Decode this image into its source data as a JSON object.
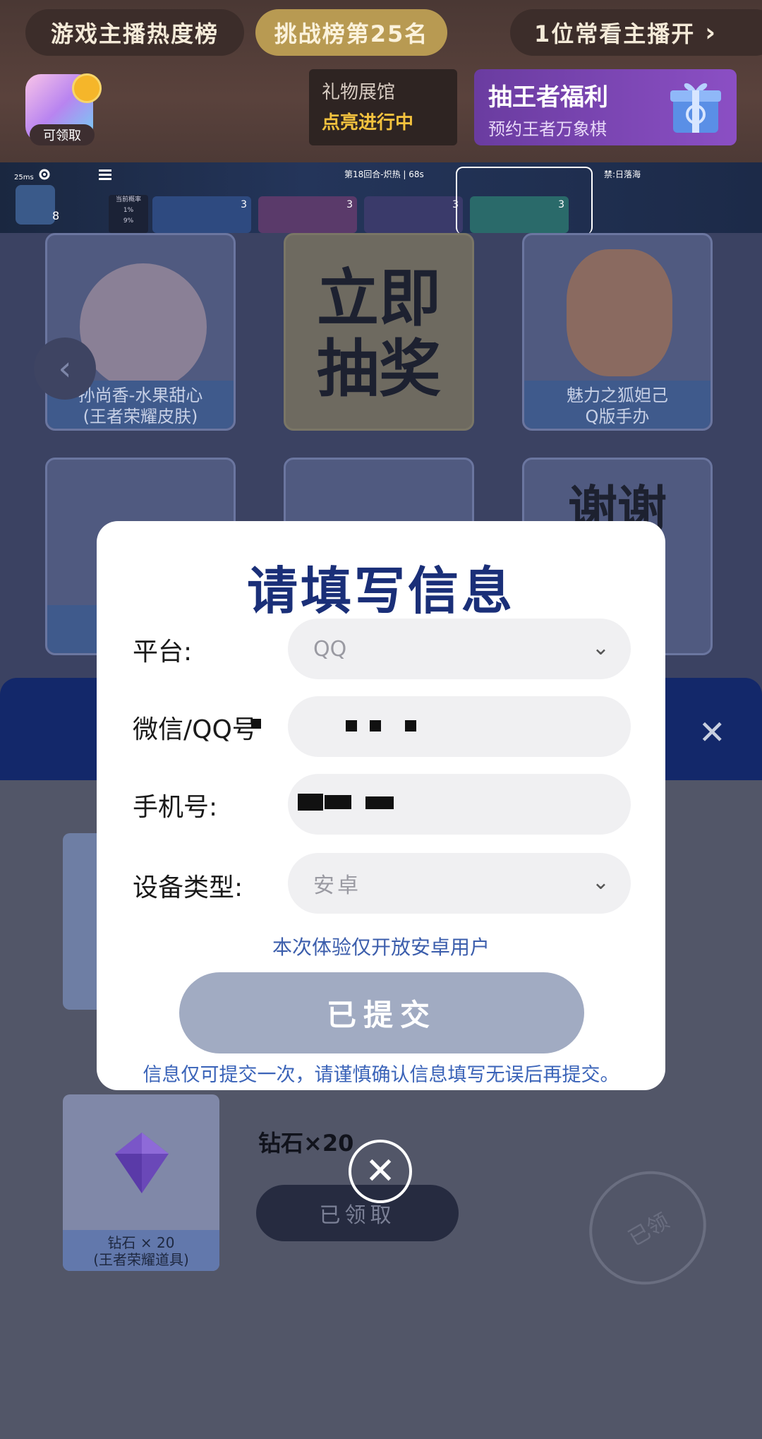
{
  "header": {
    "tabs": [
      {
        "label": "游戏主播热度榜"
      },
      {
        "label": "挑战榜第25名"
      },
      {
        "label": "1位常看主播开"
      }
    ],
    "chevron": "›",
    "app_claim_tag": "可领取",
    "gift_hall": {
      "title": "礼物展馆",
      "status": "点亮进行中"
    },
    "promo": {
      "title": "抽王者福利",
      "subtitle": "预约王者万象棋"
    }
  },
  "game": {
    "ping": "25ms",
    "round": "第18回合-炽热 | 68s",
    "mode": "禁:日落海",
    "odds": [
      "当前概率",
      "1%",
      "9%"
    ],
    "level": "8",
    "card_counts": [
      "3",
      "3",
      "3",
      "3"
    ]
  },
  "background": {
    "tiles": [
      {
        "caption": "孙尚香-水果甜心\n(王者荣耀皮肤)"
      },
      {
        "big": "立即\n抽奖"
      },
      {
        "caption": "魅力之狐妲己\nQ版手办"
      },
      {
        "caption": ""
      },
      {
        "caption": ""
      },
      {
        "big": "谢谢"
      }
    ],
    "item": {
      "caption": "钻石 × 20\n(王者荣耀道具)",
      "name": "钻石×20",
      "button": "已领取",
      "stamp": "已领"
    }
  },
  "modal": {
    "title": "请填写信息",
    "fields": [
      {
        "label": "平台:",
        "value": "QQ",
        "type": "select"
      },
      {
        "label": "微信/QQ号",
        "value": "",
        "type": "text"
      },
      {
        "label": "手机号:",
        "value": "",
        "type": "text"
      },
      {
        "label": "设备类型:",
        "value": "安卓",
        "type": "select"
      }
    ],
    "note": "本次体验仅开放安卓用户",
    "submit_label": "已提交",
    "warning": "信息仅可提交一次，请谨慎确认信息填写无误后再提交。"
  },
  "colors": {
    "modal_title": "#1a2f78",
    "note": "#3c5eac",
    "submit_disabled": "#a1abc2",
    "accent_gold": "#b89a52"
  },
  "icons": [
    "chevron-right-icon",
    "chevron-down-icon",
    "close-icon",
    "gift-box-icon",
    "gear-icon",
    "menu-icon",
    "chevron-left-icon"
  ]
}
